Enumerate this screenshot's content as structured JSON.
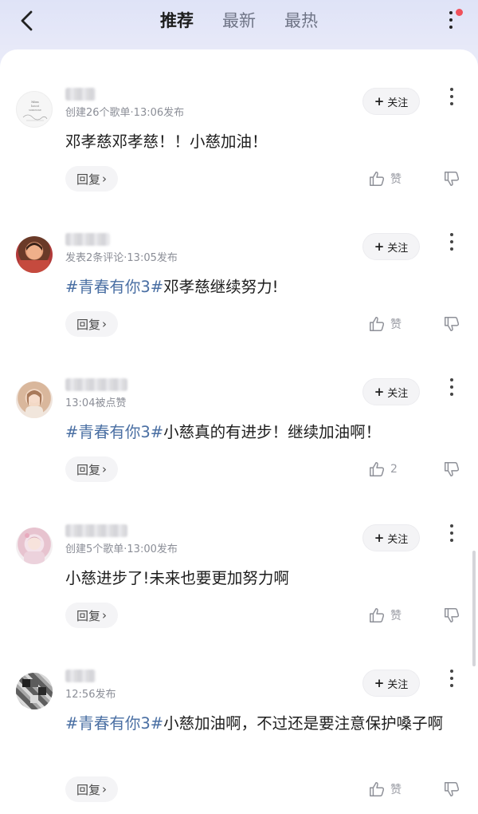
{
  "header": {
    "tabs": [
      {
        "label": "推荐",
        "active": true
      },
      {
        "label": "最新",
        "active": false
      },
      {
        "label": "最热",
        "active": false
      }
    ],
    "back_icon": "chevron-left-icon",
    "more_icon": "vertical-dots-icon",
    "notification_color": "#f0505a"
  },
  "labels": {
    "follow": "关注",
    "follow_plus": "+",
    "reply": "回复",
    "reply_arrow": "›"
  },
  "colors": {
    "hashtag": "#4a6fa3",
    "meta": "#8b8e97"
  },
  "comments": [
    {
      "meta": "创建26个歌单·13:06发布",
      "hashtag": "",
      "text": "邓孝慈邓孝慈！！小慈加油！",
      "like_label": "赞"
    },
    {
      "meta": "发表2条评论·13:05发布",
      "hashtag": "#青春有你3#",
      "text": "邓孝慈继续努力!",
      "like_label": "赞"
    },
    {
      "meta": "13:04被点赞",
      "hashtag": "#青春有你3#",
      "text": "小慈真的有进步！继续加油啊！",
      "like_label": "2"
    },
    {
      "meta": "创建5个歌单·13:00发布",
      "hashtag": "",
      "text": "小慈进步了!未来也要更加努力啊",
      "like_label": "赞"
    },
    {
      "meta": "12:56发布",
      "hashtag": "#青春有你3#",
      "text": "小慈加油啊，不过还是要注意保护嗓子啊",
      "like_label": "赞"
    }
  ]
}
